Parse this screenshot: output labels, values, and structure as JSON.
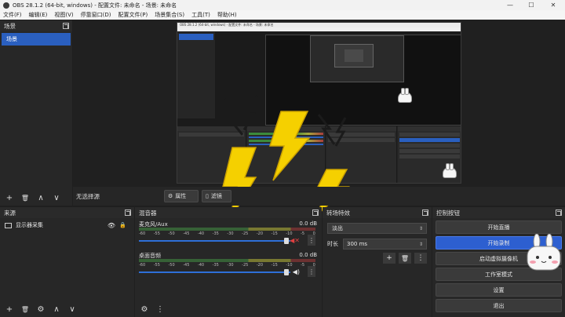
{
  "window": {
    "title": "OBS 28.1.2 (64-bit, windows) - 配置文件: 未命名 - 场景: 未命名",
    "minimize": "—",
    "maximize": "☐",
    "close": "✕"
  },
  "menu": [
    "文件(F)",
    "编辑(E)",
    "视图(V)",
    "停靠窗口(D)",
    "配置文件(P)",
    "场景集合(S)",
    "工具(T)",
    "帮助(H)"
  ],
  "scenes": {
    "title": "场景",
    "items": [
      "场景"
    ]
  },
  "preview": {
    "studio_label": "无选择源",
    "properties_button": "属性",
    "filters_button": "滤镜"
  },
  "sources": {
    "title": "来源",
    "items": [
      "显示器采集"
    ]
  },
  "mixer": {
    "title": "混音器",
    "channels": [
      {
        "name": "麦克风/Aux",
        "db": "0.0 dB",
        "level": 0.95
      },
      {
        "name": "桌面音频",
        "db": "0.0 dB",
        "level": 0.95
      }
    ],
    "scale": [
      "-60",
      "-55",
      "-50",
      "-45",
      "-40",
      "-35",
      "-30",
      "-25",
      "-20",
      "-15",
      "-10",
      "-5",
      "0"
    ]
  },
  "transitions": {
    "title": "转场特效",
    "selected": "淡出",
    "duration_label": "时长",
    "duration_value": "300 ms"
  },
  "controls": {
    "title": "控制按钮",
    "buttons": [
      "开始直播",
      "开始录制",
      "启动虚拟摄像机",
      "工作室模式",
      "设置",
      "退出"
    ],
    "active_index": 1
  },
  "nested": {
    "title": "OBS 28.1.2 (64-bit, windows) - 配置文件: 未命名 - 场景: 未命名"
  },
  "colors": {
    "accent": "#2d5fd0",
    "lightning": "#f5d000"
  },
  "icons": {
    "add": "+",
    "remove": "🗑",
    "up": "∧",
    "down": "∨",
    "more": "⋮",
    "settings": "⚙"
  }
}
